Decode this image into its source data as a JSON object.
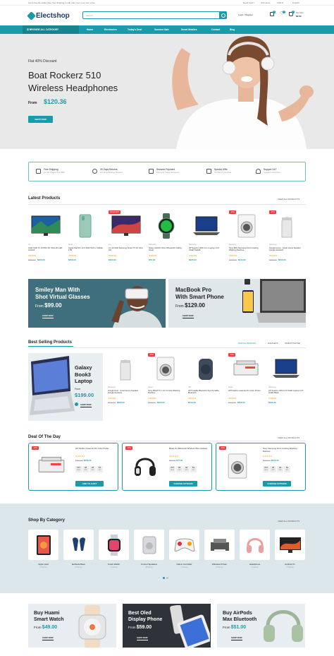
{
  "topbar": {
    "left_text": "Get a friendly deals! Also free shipping on all order over your over exbe.",
    "need_help": "Need Help?",
    "gift_cards": "Gift Cards",
    "currency": "USD $",
    "language": "English"
  },
  "header": {
    "logo_text": "Electshop",
    "search_placeholder": "Search",
    "account_label": "Login / Register",
    "compare_count": "0",
    "wishlist_count": "0",
    "cart_count": "0",
    "cart_label": "My Cart",
    "cart_total": "$0.00"
  },
  "nav": {
    "all_category": "BROWSE ALL CATEGORY",
    "items": [
      "Home",
      "Electronics",
      "Today's Deal",
      "Summer Sale",
      "Smart Mobiles",
      "Contact",
      "Blog"
    ]
  },
  "hero": {
    "discount": "Flat 40% Discount",
    "title_line1": "Boat Rockerz 510",
    "title_line2": "Wireless Headphones",
    "from_label": "From",
    "price": "$120.36",
    "button": "SHOP NOW"
  },
  "features": [
    {
      "title": "Free Shipping",
      "sub": "For All Orders Over $99",
      "icon": "truck-icon"
    },
    {
      "title": "30 Days Returns",
      "sub": "For an Exchange Product",
      "icon": "return-icon"
    },
    {
      "title": "Secured Payment",
      "sub": "Payment Cards Accepted",
      "icon": "card-icon"
    },
    {
      "title": "Special Gifts",
      "sub": "Contact us anytime",
      "icon": "gift-icon"
    },
    {
      "title": "Support 24/7",
      "sub": "Contact us anytime",
      "icon": "headset-icon"
    }
  ],
  "latest": {
    "title": "Latest Products",
    "view_all": "VIEW ALL PRODUCTS",
    "products": [
      {
        "cat": "LG",
        "name": "Intelli UHD TV 43 PRO 4K Ultra HD LED Android",
        "old": "$350.00",
        "price": "$300.00",
        "badge": ""
      },
      {
        "cat": "Apple",
        "name": "Apple iPad Pro 12.9 2022 Wi-Fi+ Cellular 1TB",
        "old": "",
        "price": "$200.00",
        "badge": ""
      },
      {
        "cat": "LG",
        "name": "LG 49 UHD Samsung Smart TV 4K Ultra HD",
        "old": "",
        "price": "$240.00",
        "badge": "SOLD OUT"
      },
      {
        "cat": "Samsung",
        "name": "Noise ColorFit Ultra 3 Bluetooth Calling Smart",
        "old": "",
        "price": "$70.00",
        "badge": ""
      },
      {
        "cat": "Samsung",
        "name": "HP Spectre x360 2-in-1 Laptop 13.5 OLED 512GB",
        "old": "",
        "price": "$225.00",
        "badge": ""
      },
      {
        "cat": "Samsung",
        "name": "Sony 8KG Samsung Front Loading Washing Machine",
        "old": "$260.00",
        "price": "$210.00",
        "badge": "-10%"
      },
      {
        "cat": "Samsung",
        "name": "Google Home - Smart Home Speaker Google Assistant",
        "old": "$300.00",
        "price": "$200.00",
        "badge": "-10%"
      }
    ]
  },
  "banner_vr": {
    "title_line1": "Smiley Man With",
    "title_line2": "Shot Virtual Glasses",
    "from_label": "From",
    "price": "$99.00",
    "link": "SHOP NOW"
  },
  "banner_macbook": {
    "title_line1": "MacBook Pro",
    "title_line2": "With Smart Phone",
    "from_label": "From",
    "price": "$129.00",
    "link": "SHOP NOW"
  },
  "bestselling": {
    "title": "Best Selling Products",
    "tabs": [
      "DIGITAL DEVICES",
      "GADGETS",
      "SMART PHONE"
    ],
    "feature": {
      "title_line1": "Galaxy",
      "title_line2": "Book3",
      "title_line3": "Laptop",
      "from_label": "From",
      "price": "$199.00",
      "link": "SHOP NOW"
    },
    "products": [
      {
        "cat": "Samsung",
        "name": "Google Nest - Smart Home Speaker Google Assistant",
        "old": "$330.00",
        "price": "$300.00",
        "badge": ""
      },
      {
        "cat": "Canon",
        "name": "Sony 8KG(6*7) 1.4m Combo Washing Machine",
        "old": "$260.00",
        "price": "$200.00",
        "badge": "-10%"
      },
      {
        "cat": "JBL",
        "name": "HP Portable Bluetooth Toys Portable Bluetooth",
        "old": "",
        "price": "$210.00",
        "badge": ""
      },
      {
        "cat": "Apple",
        "name": "HP Pavilion LaserJet Pro Color Printer",
        "old": "$330.00",
        "price": "$300.00",
        "badge": "-10%"
      },
      {
        "cat": "Samsung",
        "name": "HP Spectre x360 14.5 OLED Laptop 13.5 OLED Black",
        "old": "",
        "price": "$225.00",
        "badge": ""
      }
    ]
  },
  "deals": {
    "title": "Deal Of The Day",
    "view_all": "VIEW ALL PRODUCTS",
    "items": [
      {
        "name": "HP Pavilion LaserJet Pro Color Printer",
        "old": "$290.00",
        "price": "$250.00",
        "days": "707",
        "hours": "04",
        "mins": "42",
        "secs": "51",
        "button": "ADD TO CART",
        "badge": "-10%"
      },
      {
        "name": "Beats Pro Bluetooth Wireless Wire Headset",
        "old": "$80.00",
        "price": "$77.00",
        "days": "707",
        "hours": "04",
        "mins": "42",
        "secs": "51",
        "button": "CHOOSE OPTIONS",
        "badge": "-10%"
      },
      {
        "name": "Sony Samsung Front Loading Washing Machine",
        "old": "$290.00",
        "price": "$250.00",
        "days": "707",
        "hours": "04",
        "mins": "42",
        "secs": "51",
        "button": "CHOOSE OPTIONS",
        "badge": "-10%"
      }
    ],
    "labels": {
      "days": "DAYS",
      "hours": "HRS",
      "mins": "MIN",
      "secs": "SEC"
    }
  },
  "categories": {
    "title": "Shop By Category",
    "view_all": "VIEW ALL PRODUCTS",
    "items": [
      {
        "name": "Apple Ipad",
        "count": "(7 Items)"
      },
      {
        "name": "Earbuds Base",
        "count": "(7 Items)"
      },
      {
        "name": "Smart Watch",
        "count": "(7 Items)"
      },
      {
        "name": "Control Speakers",
        "count": "(8 Items)"
      },
      {
        "name": "Game Controller",
        "count": "(7 Items)"
      },
      {
        "name": "Wireless Printer",
        "count": "(7 Items)"
      },
      {
        "name": "Headphone",
        "count": "(7 Items)"
      },
      {
        "name": "Android Tv",
        "count": "(7 Items)"
      }
    ]
  },
  "promos": [
    {
      "title_line1": "Buy Huami",
      "title_line2": "Smart Watch",
      "from_label": "From",
      "price": "$49.00",
      "link": "SHOP NOW"
    },
    {
      "title_line1": "Best Oled",
      "title_line2": "Display Phone",
      "from_label": "From",
      "price": "$59.00",
      "link": "SHOP NOW"
    },
    {
      "title_line1": "Buy AirPods",
      "title_line2": "Max Bluetooth",
      "from_label": "From",
      "price": "$51.00",
      "link": "SHOP NOW"
    }
  ],
  "colors": {
    "accent": "#1b9aaa",
    "dark": "#2f3238",
    "sale": "#e84141"
  }
}
